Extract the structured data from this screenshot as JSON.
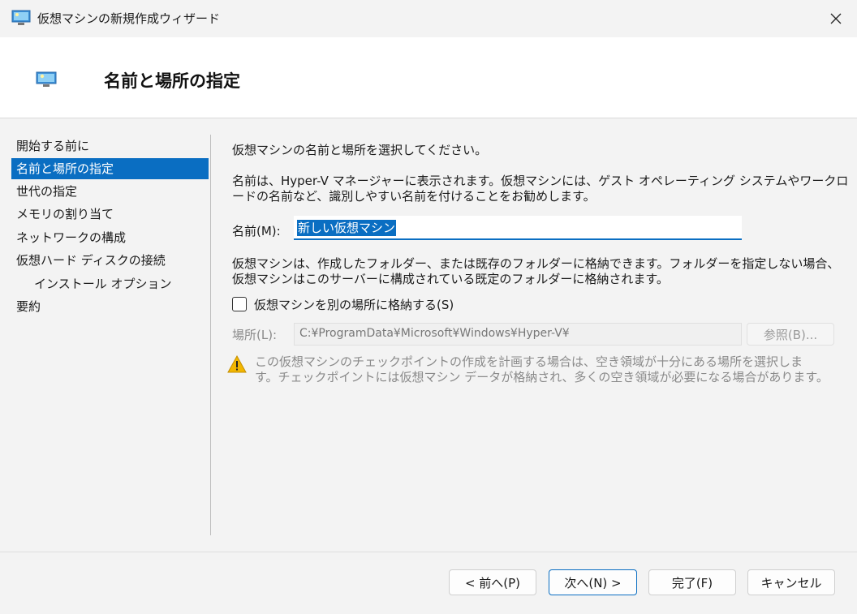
{
  "window": {
    "title": "仮想マシンの新規作成ウィザード",
    "icon": "hyper-v-monitor-icon"
  },
  "header": {
    "title": "名前と場所の指定",
    "icon": "hyper-v-monitor-icon"
  },
  "nav": {
    "items": [
      {
        "label": "開始する前に"
      },
      {
        "label": "名前と場所の指定",
        "active": true
      },
      {
        "label": "世代の指定"
      },
      {
        "label": "メモリの割り当て"
      },
      {
        "label": "ネットワークの構成"
      },
      {
        "label": "仮想ハード ディスクの接続"
      },
      {
        "label": "インストール オプション",
        "sub": true
      },
      {
        "label": "要約"
      }
    ]
  },
  "content": {
    "intro": "仮想マシンの名前と場所を選択してください。",
    "name_desc_1": "名前は、Hyper-V マネージャーに表示されます。仮想マシンには、ゲスト オペレーティング システムやワークロ",
    "name_desc_2": "ードの名前など、識別しやすい名前を付けることをお勧めします。",
    "name_label": "名前(M):",
    "name_value": "新しい仮想マシン",
    "store_desc_1": "仮想マシンは、作成したフォルダー、または既存のフォルダーに格納できます。フォルダーを指定しない場合、",
    "store_desc_2": "仮想マシンはこのサーバーに構成されている既定のフォルダーに格納されます。",
    "store_checkbox_label": "仮想マシンを別の場所に格納する(S)",
    "store_checked": false,
    "location_label": "場所(L):",
    "location_value": "C:¥ProgramData¥Microsoft¥Windows¥Hyper-V¥",
    "browse_label": "参照(B)...",
    "warning_1": "この仮想マシンのチェックポイントの作成を計画する場合は、空き領域が十分にある場所を選択しま",
    "warning_2": "す。チェックポイントには仮想マシン データが格納され、多くの空き領域が必要になる場合があります。"
  },
  "footer": {
    "prev_label": "< 前へ(P)",
    "next_label": "次へ(N) >",
    "finish_label": "完了(F)",
    "cancel_label": "キャンセル"
  },
  "colors": {
    "accent": "#0a6ec2",
    "warning": "#f2b600"
  }
}
